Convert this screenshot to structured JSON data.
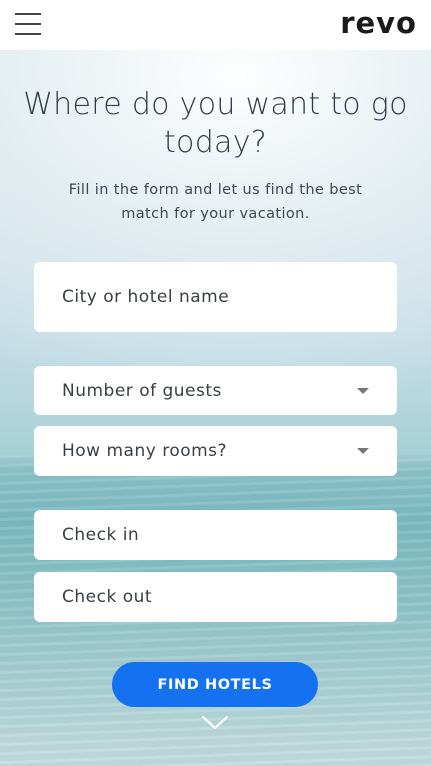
{
  "header": {
    "brand": "revo"
  },
  "hero": {
    "title": "Where do you want to go today?",
    "subtitle": "Fill in the form and let us find the best match for your vacation."
  },
  "form": {
    "destination_placeholder": "City or hotel name",
    "guests_placeholder": "Number of guests",
    "rooms_placeholder": "How many rooms?",
    "checkin_placeholder": "Check in",
    "checkout_placeholder": "Check out",
    "submit_label": "FIND HOTELS"
  },
  "colors": {
    "accent": "#1472f0",
    "header_bg": "#ffffff",
    "text": "#333c48"
  },
  "icons": {
    "menu": "hamburger-icon",
    "dropdown": "caret-down-icon",
    "scroll": "chevron-down-icon"
  }
}
